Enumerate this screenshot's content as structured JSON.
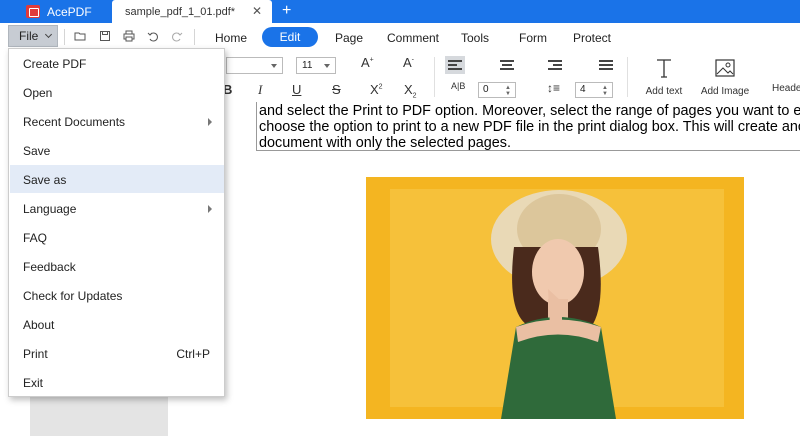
{
  "app": {
    "name": "AcePDF",
    "brand_color": "#1a73e8",
    "logo_color": "#e03a3a"
  },
  "tabs": {
    "document": "sample_pdf_1_01.pdf*",
    "close_glyph": "✕",
    "new_tab_glyph": "+"
  },
  "toolbar": {
    "file_label": "File",
    "menu_tabs": [
      "Home",
      "Edit",
      "Page",
      "Comment",
      "Tools",
      "Form",
      "Protect"
    ],
    "active_tab": "Edit",
    "quick_icons": [
      "folder-icon",
      "save-disk-icon",
      "print-icon",
      "undo-icon",
      "redo-icon"
    ]
  },
  "ribbon": {
    "font_size": "11",
    "increase_font": "A",
    "decrease_font": "A",
    "italic": "I",
    "underline": "U",
    "strikethrough": "S",
    "superscript": "X",
    "subscript": "X",
    "char_spacing_value": "0",
    "line_spacing_value": "4",
    "add_text_label": "Add text",
    "add_image_label": "Add Image",
    "header_label": "Heade"
  },
  "document": {
    "text_lines": [
      "and select the Print to PDF option. Moreover, select the range of pages you want to extra",
      "choose the option to print to a new PDF file in the print dialog box. This will create anothe",
      "document with only the selected pages."
    ],
    "photo_background": "#f4b521"
  },
  "file_menu": {
    "items": [
      {
        "label": "Create PDF",
        "submenu": false,
        "shortcut": ""
      },
      {
        "label": "Open",
        "submenu": false,
        "shortcut": ""
      },
      {
        "label": "Recent Documents",
        "submenu": true,
        "shortcut": ""
      },
      {
        "label": "Save",
        "submenu": false,
        "shortcut": ""
      },
      {
        "label": "Save as",
        "submenu": false,
        "shortcut": "",
        "hover": true
      },
      {
        "label": "Language",
        "submenu": true,
        "shortcut": ""
      },
      {
        "label": "FAQ",
        "submenu": false,
        "shortcut": ""
      },
      {
        "label": "Feedback",
        "submenu": false,
        "shortcut": ""
      },
      {
        "label": "Check for Updates",
        "submenu": false,
        "shortcut": ""
      },
      {
        "label": "About",
        "submenu": false,
        "shortcut": ""
      },
      {
        "label": "Print",
        "submenu": false,
        "shortcut": "Ctrl+P"
      },
      {
        "label": "Exit",
        "submenu": false,
        "shortcut": ""
      }
    ]
  }
}
